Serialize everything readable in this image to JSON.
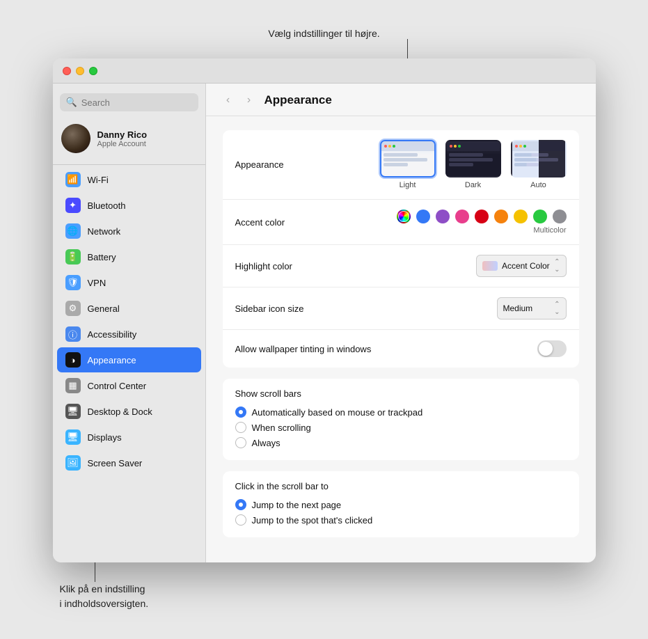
{
  "annotation": {
    "top": "Vælg indstillinger til højre.",
    "bottom_line1": "Klik på en indstilling",
    "bottom_line2": "i indholdsoversigten."
  },
  "window": {
    "title": "Appearance"
  },
  "sidebar": {
    "search_placeholder": "Search",
    "user": {
      "name": "Danny Rico",
      "subtitle": "Apple Account"
    },
    "items": [
      {
        "id": "wifi",
        "label": "Wi-Fi",
        "icon_class": "icon-wifi",
        "icon": "📶"
      },
      {
        "id": "bluetooth",
        "label": "Bluetooth",
        "icon_class": "icon-bt",
        "icon": "🔵"
      },
      {
        "id": "network",
        "label": "Network",
        "icon_class": "icon-network",
        "icon": "🌐"
      },
      {
        "id": "battery",
        "label": "Battery",
        "icon_class": "icon-battery",
        "icon": "🔋"
      },
      {
        "id": "vpn",
        "label": "VPN",
        "icon_class": "icon-vpn",
        "icon": "🌐"
      },
      {
        "id": "general",
        "label": "General",
        "icon_class": "icon-general",
        "icon": "⚙️"
      },
      {
        "id": "access",
        "label": "Accessibility",
        "icon_class": "icon-access",
        "icon": "ℹ️"
      },
      {
        "id": "appearance",
        "label": "Appearance",
        "icon_class": "icon-appear",
        "icon": "◑",
        "active": true
      },
      {
        "id": "control",
        "label": "Control Center",
        "icon_class": "icon-control",
        "icon": "⊞"
      },
      {
        "id": "desktop",
        "label": "Desktop & Dock",
        "icon_class": "icon-desktop",
        "icon": "🖥"
      },
      {
        "id": "displays",
        "label": "Displays",
        "icon_class": "icon-displays",
        "icon": "🖥"
      },
      {
        "id": "screensaver",
        "label": "Screen Saver",
        "icon_class": "icon-screen",
        "icon": "🖼"
      }
    ]
  },
  "main": {
    "title": "Appearance",
    "appearance_label": "Appearance",
    "appearance_options": [
      {
        "id": "light",
        "label": "Light",
        "selected": true
      },
      {
        "id": "dark",
        "label": "Dark",
        "selected": false
      },
      {
        "id": "auto",
        "label": "Auto",
        "selected": false
      }
    ],
    "accent_color_label": "Accent color",
    "accent_colors": [
      {
        "id": "multicolor",
        "color": "conic-gradient(red, yellow, lime, cyan, blue, magenta, red)",
        "selected": true,
        "label": "Multicolor"
      },
      {
        "id": "blue",
        "color": "#3478f6",
        "selected": false
      },
      {
        "id": "purple",
        "color": "#8e4ec6",
        "selected": false
      },
      {
        "id": "pink",
        "color": "#e83e8c",
        "selected": false
      },
      {
        "id": "red",
        "color": "#d70015",
        "selected": false
      },
      {
        "id": "orange",
        "color": "#f5820d",
        "selected": false
      },
      {
        "id": "yellow",
        "color": "#f5c100",
        "selected": false
      },
      {
        "id": "green",
        "color": "#28c940",
        "selected": false
      },
      {
        "id": "graphite",
        "color": "#8e8e93",
        "selected": false
      }
    ],
    "accent_selected_label": "Multicolor",
    "highlight_color_label": "Highlight color",
    "highlight_color_value": "Accent Color",
    "sidebar_icon_size_label": "Sidebar icon size",
    "sidebar_icon_size_value": "Medium",
    "wallpaper_tinting_label": "Allow wallpaper tinting in windows",
    "wallpaper_tinting_on": false,
    "scroll_bars_label": "Show scroll bars",
    "scroll_options": [
      {
        "id": "auto",
        "label": "Automatically based on mouse or trackpad",
        "checked": true
      },
      {
        "id": "scroll",
        "label": "When scrolling",
        "checked": false
      },
      {
        "id": "always",
        "label": "Always",
        "checked": false
      }
    ],
    "click_scroll_label": "Click in the scroll bar to",
    "click_scroll_options": [
      {
        "id": "next",
        "label": "Jump to the next page",
        "checked": true
      },
      {
        "id": "clicked",
        "label": "Jump to the spot that's clicked",
        "checked": false
      }
    ]
  }
}
